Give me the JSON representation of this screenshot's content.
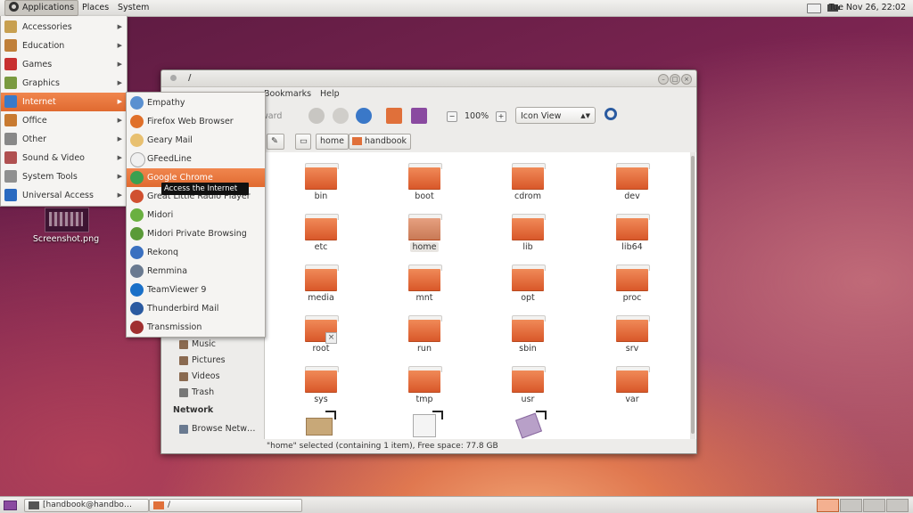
{
  "top_panel": {
    "menus": [
      "Applications",
      "Places",
      "System"
    ],
    "clock": "Tue Nov 26, 22:02"
  },
  "applications_menu": {
    "items": [
      {
        "label": "Accessories",
        "icon": "accessories-icon",
        "color": "#c8a050"
      },
      {
        "label": "Education",
        "icon": "education-icon",
        "color": "#c0803a"
      },
      {
        "label": "Games",
        "icon": "games-icon",
        "color": "#c83030"
      },
      {
        "label": "Graphics",
        "icon": "graphics-icon",
        "color": "#7a9a40"
      },
      {
        "label": "Internet",
        "icon": "internet-icon",
        "color": "#3a7ac8",
        "selected": true
      },
      {
        "label": "Office",
        "icon": "office-icon",
        "color": "#c87a30"
      },
      {
        "label": "Other",
        "icon": "other-icon",
        "color": "#888888"
      },
      {
        "label": "Sound & Video",
        "icon": "sound-video-icon",
        "color": "#b05050"
      },
      {
        "label": "System Tools",
        "icon": "system-tools-icon",
        "color": "#909090"
      },
      {
        "label": "Universal Access",
        "icon": "universal-access-icon",
        "color": "#2a6ac0"
      }
    ]
  },
  "internet_menu": {
    "items": [
      {
        "label": "Empathy",
        "icon": "empathy-icon",
        "color": "#5a90d0"
      },
      {
        "label": "Firefox Web Browser",
        "icon": "firefox-icon",
        "color": "#e0702a"
      },
      {
        "label": "Geary Mail",
        "icon": "geary-mail-icon",
        "color": "#e8c070"
      },
      {
        "label": "GFeedLine",
        "icon": "gfeedline-icon",
        "color": "#f0f0f0"
      },
      {
        "label": "Google Chrome",
        "icon": "chrome-icon",
        "color": "#3aa050",
        "selected": true
      },
      {
        "label": "Great Little Radio Player",
        "icon": "radio-icon",
        "color": "#d05030"
      },
      {
        "label": "Midori",
        "icon": "midori-icon",
        "color": "#6ab040"
      },
      {
        "label": "Midori Private Browsing",
        "icon": "midori-private-icon",
        "color": "#5a9a38"
      },
      {
        "label": "Rekonq",
        "icon": "rekonq-icon",
        "color": "#3a70c0"
      },
      {
        "label": "Remmina",
        "icon": "remmina-icon",
        "color": "#6a7a90"
      },
      {
        "label": "TeamViewer 9",
        "icon": "teamviewer-icon",
        "color": "#1a70c8"
      },
      {
        "label": "Thunderbird Mail",
        "icon": "thunderbird-icon",
        "color": "#2a5aa0"
      },
      {
        "label": "Transmission",
        "icon": "transmission-icon",
        "color": "#a03030"
      }
    ],
    "tooltip": "Access the Internet"
  },
  "desktop": {
    "file_label": "Screenshot.png"
  },
  "window": {
    "title": "/",
    "menus": [
      "Bookmarks",
      "Help"
    ],
    "back_label": "ward",
    "zoom": "100%",
    "view_mode": "Icon View",
    "path": [
      "home",
      "handbook"
    ],
    "sidebar": [
      "Music",
      "Pictures",
      "Videos",
      "Trash"
    ],
    "network_heading": "Network",
    "network_item": "Browse Netw…",
    "folders": [
      "bin",
      "boot",
      "cdrom",
      "dev",
      "etc",
      "home",
      "lib",
      "lib64",
      "media",
      "mnt",
      "opt",
      "proc",
      "root",
      "run",
      "sbin",
      "srv",
      "sys",
      "tmp",
      "usr",
      "var"
    ],
    "selected_folder": "home",
    "status": "\"home\" selected (containing 1 item), Free space: 77.8 GB"
  },
  "bottom_panel": {
    "tasks": [
      "[handbook@handbo…",
      "/"
    ]
  },
  "colors": {
    "accent": "#e8773a",
    "folder": "#e8703c"
  }
}
